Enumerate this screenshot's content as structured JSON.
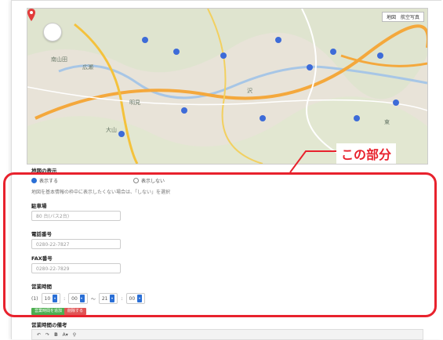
{
  "map": {
    "type_options": [
      "地図",
      "航空写真"
    ],
    "labels": [
      "南山田",
      "広瀬",
      "明見",
      "大山",
      "沢",
      "東"
    ]
  },
  "map_display": {
    "heading": "地図の表示",
    "option_show": "表示する",
    "option_hide": "表示しない",
    "hint": "地図を基本情報の枠中に表示したくない場合は、「しない」を選択"
  },
  "fields": {
    "parking": {
      "label": "駐車場",
      "value": "80 台(バス2台)"
    },
    "phone": {
      "label": "電話番号",
      "value": "0280-22-7827"
    },
    "fax": {
      "label": "FAX番号",
      "value": "0280-22-7829"
    }
  },
  "hours": {
    "label": "営業時間",
    "day": "(1)",
    "start_hour": "10",
    "start_min": "00",
    "sep": "〜",
    "end_hour": "21",
    "end_min": "00"
  },
  "buttons": {
    "add": "営業時間を追加",
    "remove": "削除する"
  },
  "toolbar_label": "営業時間の備考",
  "callout": {
    "text": "この部分"
  },
  "colors": {
    "highlight": "#e8222d",
    "accent": "#2a6fd6"
  }
}
